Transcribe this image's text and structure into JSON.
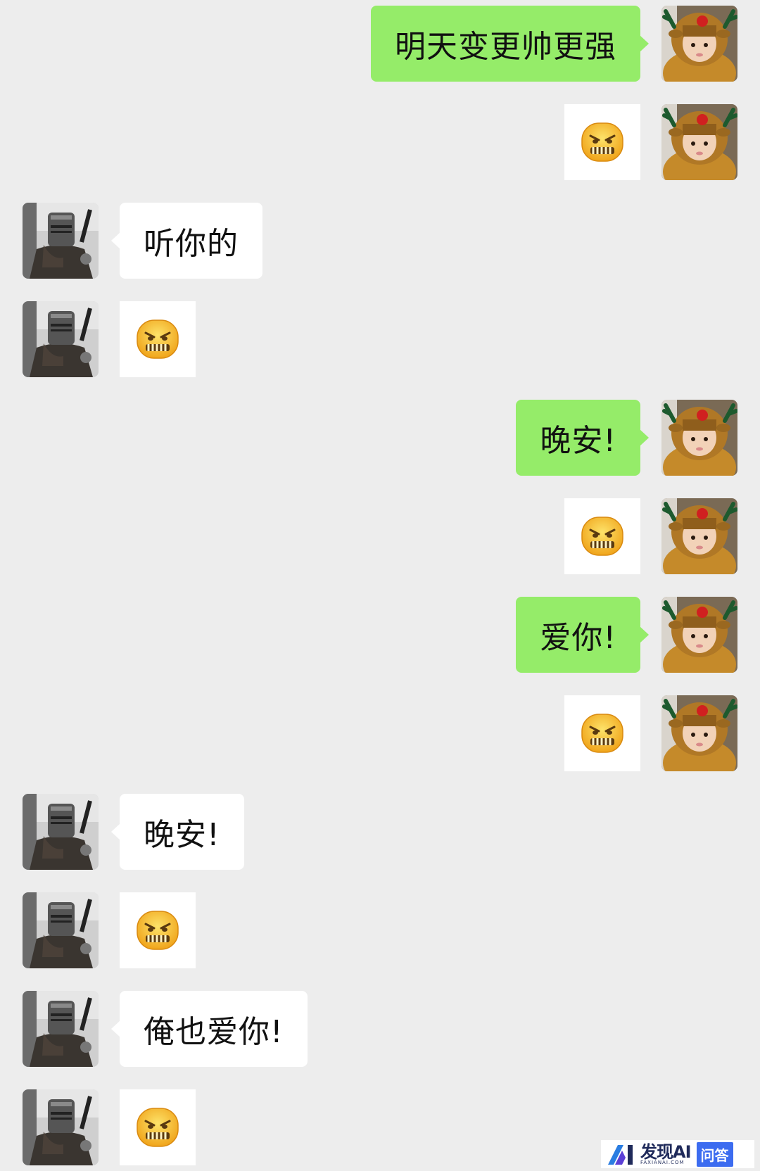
{
  "messages": [
    {
      "side": "sent",
      "kind": "text",
      "text": "明天变更帅更强"
    },
    {
      "side": "sent",
      "kind": "sticker",
      "sticker": "grimace-emoji-icon"
    },
    {
      "side": "recv",
      "kind": "text",
      "text": "听你的"
    },
    {
      "side": "recv",
      "kind": "sticker",
      "sticker": "grimace-emoji-icon"
    },
    {
      "side": "sent",
      "kind": "text",
      "text": "晚安!"
    },
    {
      "side": "sent",
      "kind": "sticker",
      "sticker": "grimace-emoji-icon"
    },
    {
      "side": "sent",
      "kind": "text",
      "text": "爱你!"
    },
    {
      "side": "sent",
      "kind": "sticker",
      "sticker": "grimace-emoji-icon"
    },
    {
      "side": "recv",
      "kind": "text",
      "text": "晚安!"
    },
    {
      "side": "recv",
      "kind": "sticker",
      "sticker": "grimace-emoji-icon"
    },
    {
      "side": "recv",
      "kind": "text",
      "text": "俺也爱你!"
    },
    {
      "side": "recv",
      "kind": "sticker",
      "sticker": "grimace-emoji-icon"
    }
  ],
  "avatars": {
    "sent": "reindeer-costume-child-avatar",
    "recv": "knight-helmet-avatar"
  },
  "colors": {
    "background": "#ededed",
    "sent_bubble": "#95ec69",
    "recv_bubble": "#ffffff"
  },
  "watermark": {
    "brand": "发现AI",
    "sub": "FAXIANAI.COM",
    "tag": "问答"
  }
}
